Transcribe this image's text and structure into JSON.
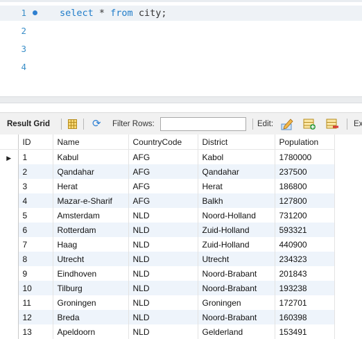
{
  "editor": {
    "lines": [
      {
        "num": "1",
        "kw1": "select",
        "mid": " * ",
        "kw2": "from",
        "ident": " city;"
      },
      {
        "num": "2"
      },
      {
        "num": "3"
      },
      {
        "num": "4"
      }
    ]
  },
  "toolbar": {
    "result_grid": "Result Grid",
    "filter_rows": "Filter Rows:",
    "filter_value": "",
    "edit": "Edit:",
    "export": "Ex"
  },
  "grid": {
    "columns": [
      "ID",
      "Name",
      "CountryCode",
      "District",
      "Population"
    ],
    "rows": [
      [
        "1",
        "Kabul",
        "AFG",
        "Kabol",
        "1780000"
      ],
      [
        "2",
        "Qandahar",
        "AFG",
        "Qandahar",
        "237500"
      ],
      [
        "3",
        "Herat",
        "AFG",
        "Herat",
        "186800"
      ],
      [
        "4",
        "Mazar-e-Sharif",
        "AFG",
        "Balkh",
        "127800"
      ],
      [
        "5",
        "Amsterdam",
        "NLD",
        "Noord-Holland",
        "731200"
      ],
      [
        "6",
        "Rotterdam",
        "NLD",
        "Zuid-Holland",
        "593321"
      ],
      [
        "7",
        "Haag",
        "NLD",
        "Zuid-Holland",
        "440900"
      ],
      [
        "8",
        "Utrecht",
        "NLD",
        "Utrecht",
        "234323"
      ],
      [
        "9",
        "Eindhoven",
        "NLD",
        "Noord-Brabant",
        "201843"
      ],
      [
        "10",
        "Tilburg",
        "NLD",
        "Noord-Brabant",
        "193238"
      ],
      [
        "11",
        "Groningen",
        "NLD",
        "Groningen",
        "172701"
      ],
      [
        "12",
        "Breda",
        "NLD",
        "Noord-Brabant",
        "160398"
      ],
      [
        "13",
        "Apeldoorn",
        "NLD",
        "Gelderland",
        "153491"
      ]
    ],
    "current_row_marker": "▶"
  },
  "icons": {
    "grid": "result-grid-layout-icon",
    "refresh": "refresh-icon",
    "edit": "edit-pencil-icon",
    "add_row": "add-row-icon",
    "delete_row": "delete-row-icon"
  },
  "colors": {
    "keyword": "#1f7cc9",
    "line_number": "#3a8ec8",
    "alt_row": "#eef4fb"
  }
}
